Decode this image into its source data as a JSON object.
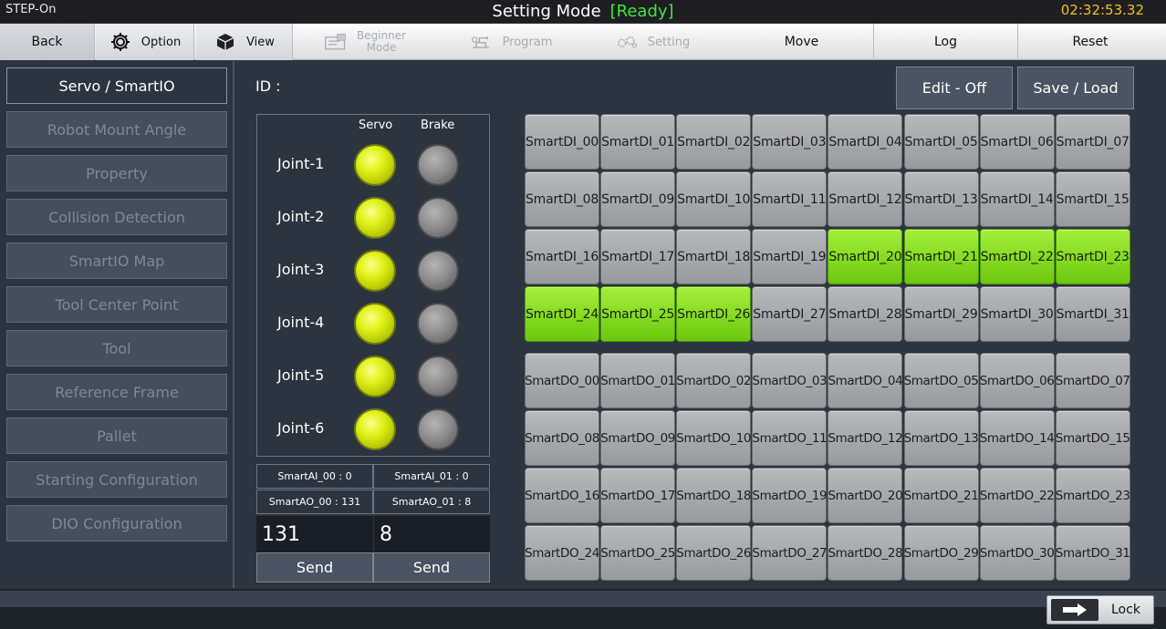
{
  "title": {
    "left": "STEP-On",
    "mode": "Setting Mode",
    "status": "[Ready]",
    "clock": "02:32:53.32"
  },
  "menu": {
    "back": "Back",
    "option": "Option",
    "view": "View",
    "beginner_line1": "Beginner",
    "beginner_line2": "Mode",
    "program": "Program",
    "setting": "Setting",
    "move": "Move",
    "log": "Log",
    "reset": "Reset"
  },
  "sidebar": {
    "items": [
      "Servo / SmartIO",
      "Robot Mount Angle",
      "Property",
      "Collision Detection",
      "SmartIO Map",
      "Tool Center Point",
      "Tool",
      "Reference Frame",
      "Pallet",
      "Starting Configuration",
      "DIO Configuration"
    ]
  },
  "main": {
    "id_label": "ID :",
    "edit_button": "Edit - Off",
    "save_button": "Save / Load"
  },
  "joints": {
    "servo_header": "Servo",
    "brake_header": "Brake",
    "rows": [
      {
        "name": "Joint-1",
        "servo": true,
        "brake": false
      },
      {
        "name": "Joint-2",
        "servo": true,
        "brake": false
      },
      {
        "name": "Joint-3",
        "servo": true,
        "brake": false
      },
      {
        "name": "Joint-4",
        "servo": true,
        "brake": false
      },
      {
        "name": "Joint-5",
        "servo": true,
        "brake": false
      },
      {
        "name": "Joint-6",
        "servo": true,
        "brake": false
      }
    ]
  },
  "analog": {
    "ai0": "SmartAI_00 : 0",
    "ai1": "SmartAI_01 : 0",
    "ao0": "SmartAO_00 : 131",
    "ao1": "SmartAO_01 : 8",
    "ao0_value": "131",
    "ao1_value": "8",
    "send": "Send"
  },
  "io": {
    "di": [
      {
        "label": "SmartDI_00",
        "on": false
      },
      {
        "label": "SmartDI_01",
        "on": false
      },
      {
        "label": "SmartDI_02",
        "on": false
      },
      {
        "label": "SmartDI_03",
        "on": false
      },
      {
        "label": "SmartDI_04",
        "on": false
      },
      {
        "label": "SmartDI_05",
        "on": false
      },
      {
        "label": "SmartDI_06",
        "on": false
      },
      {
        "label": "SmartDI_07",
        "on": false
      },
      {
        "label": "SmartDI_08",
        "on": false
      },
      {
        "label": "SmartDI_09",
        "on": false
      },
      {
        "label": "SmartDI_10",
        "on": false
      },
      {
        "label": "SmartDI_11",
        "on": false
      },
      {
        "label": "SmartDI_12",
        "on": false
      },
      {
        "label": "SmartDI_13",
        "on": false
      },
      {
        "label": "SmartDI_14",
        "on": false
      },
      {
        "label": "SmartDI_15",
        "on": false
      },
      {
        "label": "SmartDI_16",
        "on": false
      },
      {
        "label": "SmartDI_17",
        "on": false
      },
      {
        "label": "SmartDI_18",
        "on": false
      },
      {
        "label": "SmartDI_19",
        "on": false
      },
      {
        "label": "SmartDI_20",
        "on": true
      },
      {
        "label": "SmartDI_21",
        "on": true
      },
      {
        "label": "SmartDI_22",
        "on": true
      },
      {
        "label": "SmartDI_23",
        "on": true
      },
      {
        "label": "SmartDI_24",
        "on": true
      },
      {
        "label": "SmartDI_25",
        "on": true
      },
      {
        "label": "SmartDI_26",
        "on": true
      },
      {
        "label": "SmartDI_27",
        "on": false
      },
      {
        "label": "SmartDI_28",
        "on": false
      },
      {
        "label": "SmartDI_29",
        "on": false
      },
      {
        "label": "SmartDI_30",
        "on": false
      },
      {
        "label": "SmartDI_31",
        "on": false
      }
    ],
    "do": [
      {
        "label": "SmartDO_00",
        "on": false
      },
      {
        "label": "SmartDO_01",
        "on": false
      },
      {
        "label": "SmartDO_02",
        "on": false
      },
      {
        "label": "SmartDO_03",
        "on": false
      },
      {
        "label": "SmartDO_04",
        "on": false
      },
      {
        "label": "SmartDO_05",
        "on": false
      },
      {
        "label": "SmartDO_06",
        "on": false
      },
      {
        "label": "SmartDO_07",
        "on": false
      },
      {
        "label": "SmartDO_08",
        "on": false
      },
      {
        "label": "SmartDO_09",
        "on": false
      },
      {
        "label": "SmartDO_10",
        "on": false
      },
      {
        "label": "SmartDO_11",
        "on": false
      },
      {
        "label": "SmartDO_12",
        "on": false
      },
      {
        "label": "SmartDO_13",
        "on": false
      },
      {
        "label": "SmartDO_14",
        "on": false
      },
      {
        "label": "SmartDO_15",
        "on": false
      },
      {
        "label": "SmartDO_16",
        "on": false
      },
      {
        "label": "SmartDO_17",
        "on": false
      },
      {
        "label": "SmartDO_18",
        "on": false
      },
      {
        "label": "SmartDO_19",
        "on": false
      },
      {
        "label": "SmartDO_20",
        "on": false
      },
      {
        "label": "SmartDO_21",
        "on": false
      },
      {
        "label": "SmartDO_22",
        "on": false
      },
      {
        "label": "SmartDO_23",
        "on": false
      },
      {
        "label": "SmartDO_24",
        "on": false
      },
      {
        "label": "SmartDO_25",
        "on": false
      },
      {
        "label": "SmartDO_26",
        "on": false
      },
      {
        "label": "SmartDO_27",
        "on": false
      },
      {
        "label": "SmartDO_28",
        "on": false
      },
      {
        "label": "SmartDO_29",
        "on": false
      },
      {
        "label": "SmartDO_30",
        "on": false
      },
      {
        "label": "SmartDO_31",
        "on": false
      }
    ]
  },
  "bottom": {
    "lock": "Lock"
  },
  "colors": {
    "io_on": "#7ad81a",
    "led_on": "#e2f21a",
    "status_ready": "#3ee83e",
    "clock": "#f2c318"
  },
  "icons": {
    "option": "gear-icon",
    "view": "cube-icon",
    "beginner": "beginner-mode-icon",
    "program": "program-icon",
    "setting": "setting-gears-icon",
    "lock": "arrow-right-icon"
  }
}
